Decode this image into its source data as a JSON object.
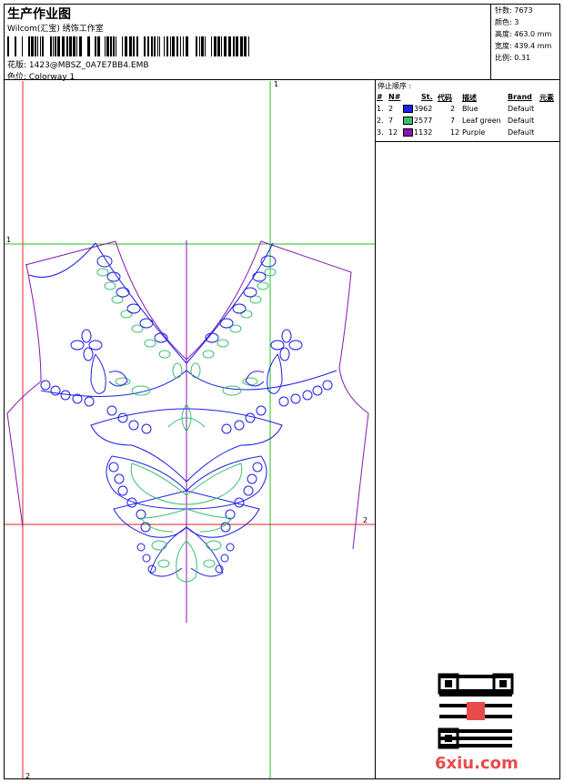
{
  "header": {
    "title": "生产作业图",
    "company": "Wilcom(汇宝) 绣饰工作室",
    "file_label": "花版: 1423@MBSZ_0A7E7BB4.EMB",
    "colorway_label": "色位: Colorway 1"
  },
  "stats": [
    {
      "label": "针数: 7673"
    },
    {
      "label": "颜色: 3"
    },
    {
      "label": "高度: 463.0 mm"
    },
    {
      "label": "宽度: 439.4 mm"
    },
    {
      "label": "比例: 0.31"
    }
  ],
  "stop_sequence": {
    "title": "停止顺序 :",
    "headers": [
      "#",
      "N#",
      "St.",
      "代码",
      "描述",
      "Brand",
      "元素"
    ],
    "rows": [
      {
        "idx": "1.",
        "n": "2",
        "color": "#1e1ee6",
        "st": "3962",
        "code": "2",
        "desc": "Blue",
        "brand": "Default"
      },
      {
        "idx": "2.",
        "n": "7",
        "color": "#3cbf6e",
        "st": "2577",
        "code": "7",
        "desc": "Leaf green",
        "brand": "Default"
      },
      {
        "idx": "3.",
        "n": "12",
        "color": "#8a15b0",
        "st": "1132",
        "code": "12",
        "desc": "Purple",
        "brand": "Default"
      }
    ]
  },
  "guides": {
    "v1": "1",
    "h1": "1",
    "h2": "2",
    "v2": "2"
  },
  "watermark": "6xiu.com",
  "colors": {
    "blue": "#1e1ee6",
    "green": "#3cbf6e",
    "purple": "#8a15b0",
    "guide_red": "#e02020",
    "guide_green": "#22c022"
  }
}
